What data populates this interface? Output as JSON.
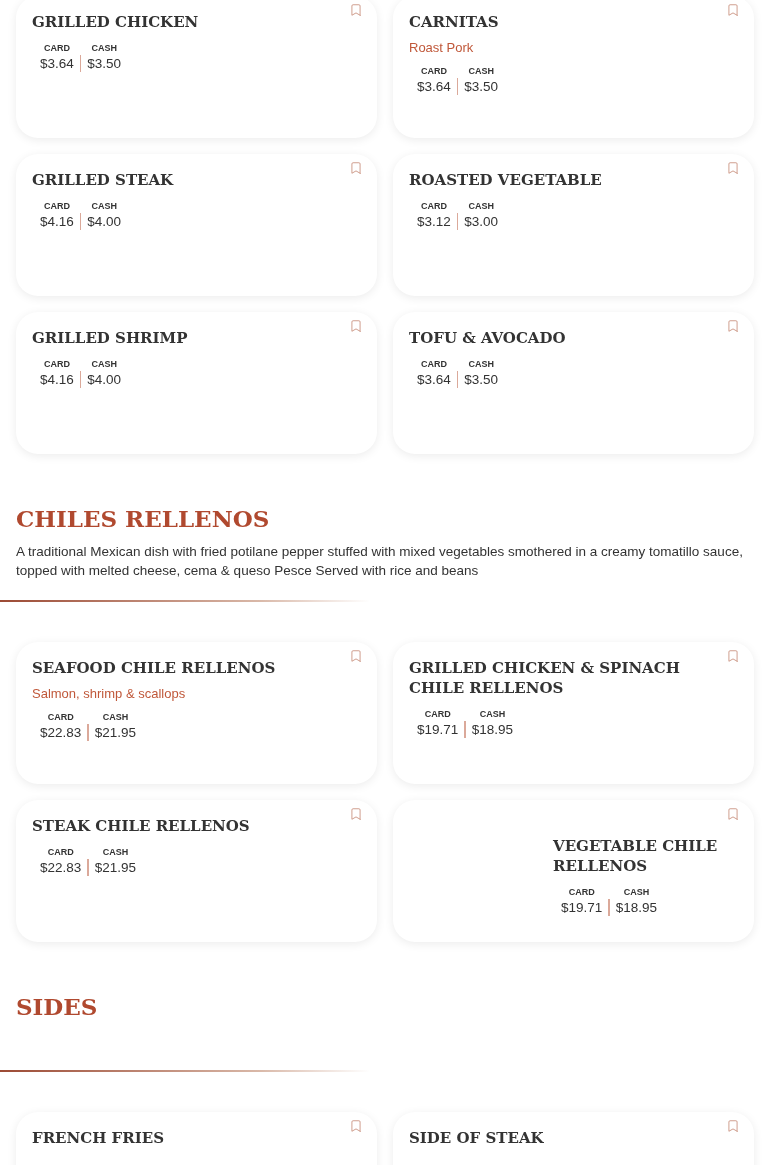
{
  "sections": [
    {
      "items": [
        {
          "name": "GRILLED CHICKEN",
          "kind": "plain",
          "prices": [
            {
              "label": "CARD",
              "amount": "$3.64"
            },
            {
              "label": "CASH",
              "amount": "$3.50"
            }
          ]
        },
        {
          "name": "CARNITAS",
          "subtitle": "Roast Pork",
          "kind": "plain",
          "prices": [
            {
              "label": "CARD",
              "amount": "$3.64"
            },
            {
              "label": "CASH",
              "amount": "$3.50"
            }
          ]
        },
        {
          "name": "GRILLED STEAK",
          "kind": "plain",
          "prices": [
            {
              "label": "CARD",
              "amount": "$4.16"
            },
            {
              "label": "CASH",
              "amount": "$4.00"
            }
          ]
        },
        {
          "name": "ROASTED VEGETABLE",
          "kind": "plain",
          "prices": [
            {
              "label": "CARD",
              "amount": "$3.12"
            },
            {
              "label": "CASH",
              "amount": "$3.00"
            }
          ]
        },
        {
          "name": "GRILLED SHRIMP",
          "kind": "plain",
          "prices": [
            {
              "label": "CARD",
              "amount": "$4.16"
            },
            {
              "label": "CASH",
              "amount": "$4.00"
            }
          ]
        },
        {
          "name": "TOFU & AVOCADO",
          "kind": "plain",
          "prices": [
            {
              "label": "CARD",
              "amount": "$3.64"
            },
            {
              "label": "CASH",
              "amount": "$3.50"
            }
          ]
        }
      ]
    },
    {
      "title": "CHILES RELLENOS",
      "description": "A traditional Mexican dish with fried potilane pepper stuffed with mixed vegetables smothered in a creamy tomatillo sauce, topped with melted cheese, cema & queso Pesce Served with rice and beans",
      "items": [
        {
          "name": "SEAFOOD CHILE RELLENOS",
          "subtitle": "Salmon, shrimp & scallops",
          "kind": "plain",
          "prices": [
            {
              "label": "CARD",
              "amount": "$22.83"
            },
            {
              "label": "CASH",
              "amount": "$21.95"
            }
          ]
        },
        {
          "name": "GRILLED CHICKEN & SPINACH CHILE RELLENOS",
          "kind": "plain",
          "prices": [
            {
              "label": "CARD",
              "amount": "$19.71"
            },
            {
              "label": "CASH",
              "amount": "$18.95"
            }
          ]
        },
        {
          "name": "STEAK CHILE RELLENOS",
          "kind": "plain",
          "prices": [
            {
              "label": "CARD",
              "amount": "$22.83"
            },
            {
              "label": "CASH",
              "amount": "$21.95"
            }
          ]
        },
        {
          "name": "VEGETABLE CHILE RELLENOS",
          "kind": "offset",
          "prices": [
            {
              "label": "CARD",
              "amount": "$19.71"
            },
            {
              "label": "CASH",
              "amount": "$18.95"
            }
          ]
        }
      ]
    },
    {
      "title": "SIDES",
      "items": [
        {
          "name": "FRENCH FRIES",
          "kind": "plain"
        },
        {
          "name": "SIDE OF STEAK",
          "kind": "plain"
        }
      ]
    }
  ]
}
